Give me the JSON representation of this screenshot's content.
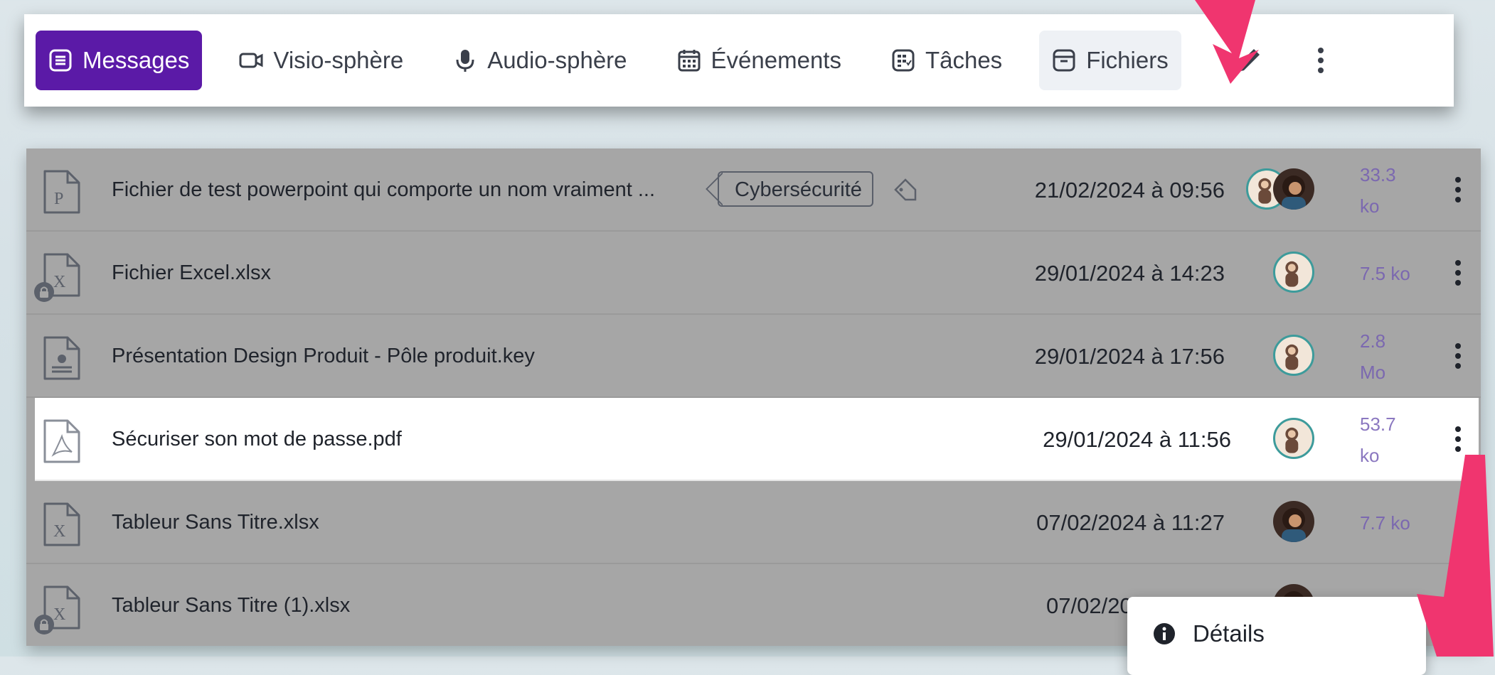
{
  "tabs": [
    {
      "label": "Messages",
      "icon": "message-list-icon"
    },
    {
      "label": "Visio-sphère",
      "icon": "video-camera-icon"
    },
    {
      "label": "Audio-sphère",
      "icon": "microphone-icon"
    },
    {
      "label": "Événements",
      "icon": "calendar-icon"
    },
    {
      "label": "Tâches",
      "icon": "tasks-board-icon"
    },
    {
      "label": "Fichiers",
      "icon": "file-box-icon"
    }
  ],
  "toolbar": {
    "edit_icon": "pencil-icon",
    "more_icon": "kebab-menu-icon"
  },
  "files": [
    {
      "name": "Fichier de test powerpoint qui comporte un nom vraiment ...",
      "tag": "Cybersécurité",
      "date": "21/02/2024 à 09:56",
      "size_line1": "33.3",
      "size_line2": "ko",
      "icon": "powerpoint-file-icon"
    },
    {
      "name": "Fichier Excel.xlsx",
      "date": "29/01/2024 à 14:23",
      "size_line1": "7.5 ko",
      "size_line2": "",
      "icon": "excel-file-icon",
      "locked": true
    },
    {
      "name": "Présentation Design Produit - Pôle produit.key",
      "date": "29/01/2024 à 17:56",
      "size_line1": "2.8",
      "size_line2": "Mo",
      "icon": "presentation-file-icon"
    },
    {
      "name": "Sécuriser son mot de passe.pdf",
      "date": "29/01/2024 à 11:56",
      "size_line1": "53.7",
      "size_line2": "ko",
      "icon": "pdf-file-icon"
    },
    {
      "name": "Tableur Sans Titre.xlsx",
      "date": "07/02/2024 à 11:27",
      "size_line1": "7.7 ko",
      "size_line2": "",
      "icon": "excel-file-icon"
    },
    {
      "name": "Tableur Sans Titre (1).xlsx",
      "date": "07/02/2024",
      "size_line1": "",
      "size_line2": "",
      "icon": "excel-file-icon",
      "locked": true
    }
  ],
  "context_menu": {
    "details_label": "Détails",
    "details_icon": "info-circle-icon"
  },
  "colors": {
    "accent": "#5b1aa7",
    "arrow": "#f0356f",
    "size_text": "#7b68b0"
  }
}
